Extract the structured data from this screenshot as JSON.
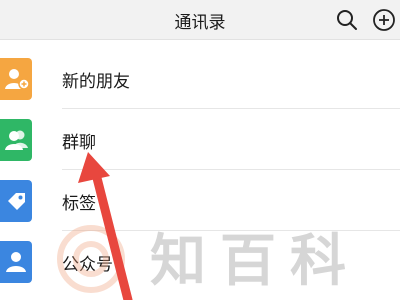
{
  "header": {
    "title": "通讯录"
  },
  "icons": {
    "search": "search-icon",
    "add": "add-icon"
  },
  "items": [
    {
      "label": "新的朋友",
      "color": "#f5a641",
      "icon": "add-friend-icon"
    },
    {
      "label": "群聊",
      "color": "#2fb766",
      "icon": "group-icon"
    },
    {
      "label": "标签",
      "color": "#3b86e0",
      "icon": "tag-icon"
    },
    {
      "label": "公众号",
      "color": "#3b86e0",
      "icon": "official-account-icon"
    }
  ],
  "watermark": {
    "text": "知百科"
  },
  "annotation": {
    "color": "#e8473e"
  }
}
